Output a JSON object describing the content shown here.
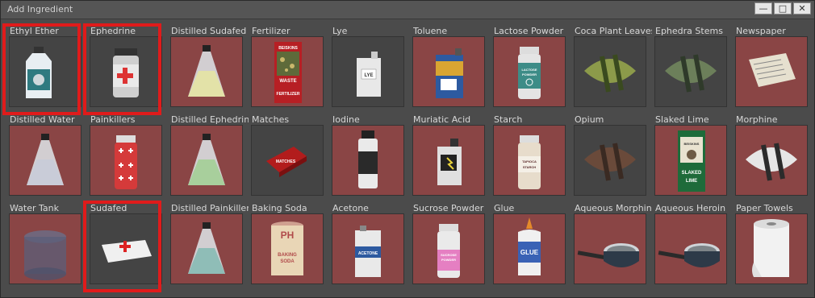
{
  "window": {
    "title": "Add Ingredient",
    "buttons": [
      "—",
      "□",
      "✕"
    ]
  },
  "items": [
    {
      "label": "Ethyl Ether",
      "bg": "dark",
      "icon": "ethyl-ether-bottle-icon",
      "selected": true
    },
    {
      "label": "Ephedrine",
      "bg": "dark",
      "icon": "ephedrine-jar-icon",
      "selected": true
    },
    {
      "label": "Distilled Sudafed",
      "bg": "red",
      "icon": "flask-yellow-icon",
      "selected": false
    },
    {
      "label": "Fertilizer",
      "bg": "red",
      "icon": "fertilizer-bag-icon",
      "selected": false
    },
    {
      "label": "Lye",
      "bg": "dark",
      "icon": "lye-jug-icon",
      "selected": false
    },
    {
      "label": "Toluene",
      "bg": "red",
      "icon": "toluene-can-icon",
      "selected": false
    },
    {
      "label": "Lactose Powder",
      "bg": "red",
      "icon": "lactose-jar-icon",
      "selected": false
    },
    {
      "label": "Coca Plant Leaves",
      "bg": "dark",
      "icon": "coca-leaves-bundle-icon",
      "selected": false
    },
    {
      "label": "Ephedra Stems",
      "bg": "dark",
      "icon": "ephedra-stems-bundle-icon",
      "selected": false
    },
    {
      "label": "Newspaper",
      "bg": "red",
      "icon": "newspaper-icon",
      "selected": false
    },
    {
      "label": "Distilled Water",
      "bg": "red",
      "icon": "flask-water-icon",
      "selected": false
    },
    {
      "label": "Painkillers",
      "bg": "red",
      "icon": "painkillers-jar-icon",
      "selected": false
    },
    {
      "label": "Distilled Ephedrine",
      "bg": "red",
      "icon": "flask-green-icon",
      "selected": false
    },
    {
      "label": "Matches",
      "bg": "dark",
      "icon": "matches-box-icon",
      "selected": false
    },
    {
      "label": "Iodine",
      "bg": "red",
      "icon": "iodine-bottle-icon",
      "selected": false
    },
    {
      "label": "Muriatic Acid",
      "bg": "red",
      "icon": "muriatic-acid-jug-icon",
      "selected": false
    },
    {
      "label": "Starch",
      "bg": "red",
      "icon": "starch-jar-icon",
      "selected": false
    },
    {
      "label": "Opium",
      "bg": "dark",
      "icon": "opium-bundle-icon",
      "selected": false
    },
    {
      "label": "Slaked Lime",
      "bg": "red",
      "icon": "slaked-lime-bag-icon",
      "selected": false
    },
    {
      "label": "Morphine",
      "bg": "red",
      "icon": "morphine-bundle-icon",
      "selected": false
    },
    {
      "label": "Water Tank",
      "bg": "red",
      "icon": "water-tank-icon",
      "selected": false
    },
    {
      "label": "Sudafed",
      "bg": "dark",
      "icon": "sudafed-box-icon",
      "selected": true
    },
    {
      "label": "Distilled Painkillers",
      "bg": "red",
      "icon": "flask-teal-icon",
      "selected": false
    },
    {
      "label": "Baking Soda",
      "bg": "red",
      "icon": "baking-soda-can-icon",
      "selected": false
    },
    {
      "label": "Acetone",
      "bg": "red",
      "icon": "acetone-can-icon",
      "selected": false
    },
    {
      "label": "Sucrose Powder",
      "bg": "red",
      "icon": "sucrose-jar-icon",
      "selected": false
    },
    {
      "label": "Glue",
      "bg": "red",
      "icon": "glue-bottle-icon",
      "selected": false
    },
    {
      "label": "Aqueous Morphine",
      "bg": "red",
      "icon": "pot-icon",
      "selected": false
    },
    {
      "label": "Aqueous Heroin",
      "bg": "red",
      "icon": "pot-icon",
      "selected": false
    },
    {
      "label": "Paper Towels",
      "bg": "red",
      "icon": "paper-towels-icon",
      "selected": false
    }
  ],
  "icon_text": {
    "fertilizer": [
      "BEISKINS",
      "WASTE",
      "FERTILIZER"
    ],
    "lactose": [
      "LACTOSE",
      "POWDER"
    ],
    "starch": [
      "TAPIOCA",
      "STARCH"
    ],
    "slaked_lime": [
      "BEISKINS",
      "SLAKED",
      "LIME"
    ],
    "matches": "MATCHES",
    "baking_soda": [
      "PH",
      "BAKING",
      "SODA"
    ],
    "glue": "GLUE",
    "lye": "LYE",
    "acetone": "ACETONE",
    "sucrose": [
      "SUCROSE",
      "POWDER"
    ]
  },
  "colors": {
    "tile_red": "#8a4545",
    "tile_dark": "#444444",
    "selection": "#e01b1b"
  }
}
